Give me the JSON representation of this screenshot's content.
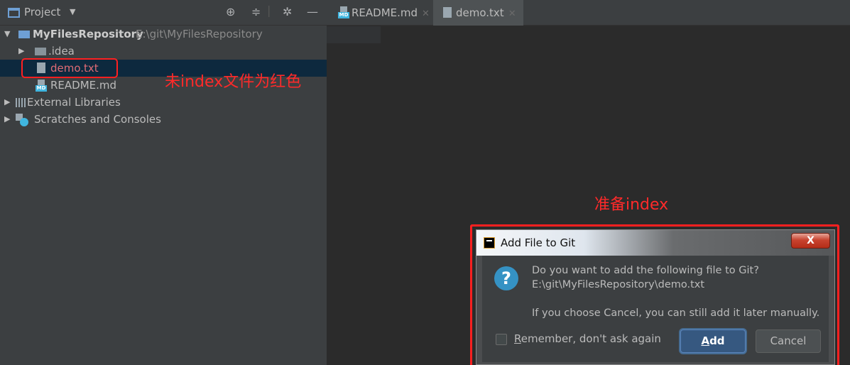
{
  "project_panel": {
    "title": "Project",
    "tree": [
      {
        "label": "MyFilesRepository",
        "path": "E:\\git\\MyFilesRepository"
      },
      {
        "label": ".idea"
      },
      {
        "label": "demo.txt"
      },
      {
        "label": "README.md"
      },
      {
        "label": "External Libraries"
      },
      {
        "label": "Scratches and Consoles"
      }
    ],
    "md_badge": "MD"
  },
  "annotations": {
    "unindexed": "未index文件为红色",
    "prepare": "准备index"
  },
  "tabs": [
    {
      "label": "README.md",
      "active": false
    },
    {
      "label": "demo.txt",
      "active": true
    }
  ],
  "dialog": {
    "title": "Add File to Git",
    "close": "X",
    "question_line1": "Do you want to add the following file to Git?",
    "question_line2": "E:\\git\\MyFilesRepository\\demo.txt",
    "hint": "If you choose Cancel, you can still add it later manually.",
    "remember_mnemonic": "R",
    "remember_rest": "emember, don't ask again",
    "add_mnemonic": "A",
    "add_rest": "dd",
    "cancel": "Cancel"
  },
  "colors": {
    "annotation_red": "#ff2a2a",
    "selection": "#0d293e",
    "primary_button": "#365880"
  }
}
